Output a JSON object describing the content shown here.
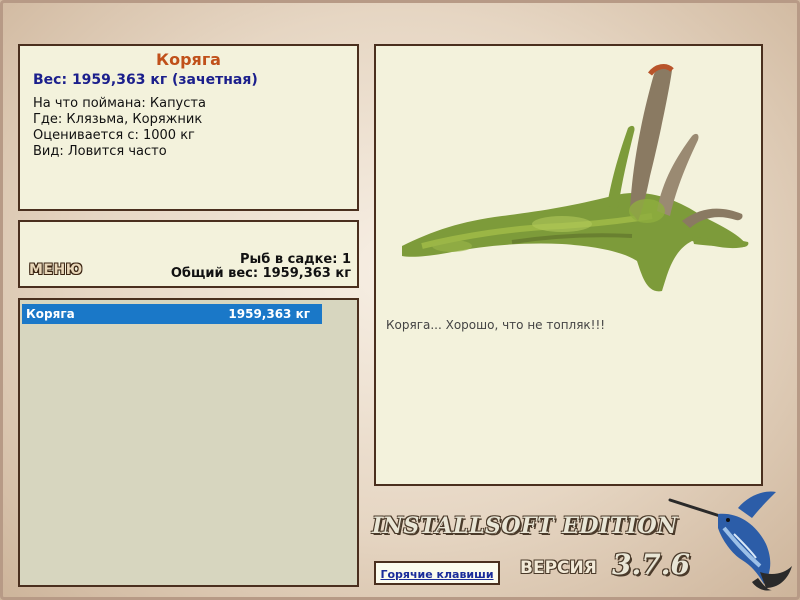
{
  "info": {
    "title": "Коряга",
    "weight": "Вес: 1959,363 кг (зачетная)",
    "lines": [
      "На что поймана: Капуста",
      "Где: Клязьма, Коряжник",
      "Оценивается с: 1000 кг",
      "Вид: Ловится часто"
    ]
  },
  "summary": {
    "menu_label": "МЕНЮ",
    "count": "Рыб в садке: 1",
    "total": "Общий вес: 1959,363 кг"
  },
  "catch_list": [
    {
      "name": "Коряга",
      "weight": "1959,363 кг",
      "selected": true
    }
  ],
  "detail": {
    "image": "driftwood-snag-photo",
    "comment": "Коряга... Хорошо, что не топляк!!!"
  },
  "footer": {
    "hotkeys_link": "Горячие клавиши",
    "brand": "INSTALLSOFT EDITION",
    "version_label": "ВЕРСИЯ",
    "version_number": "3.7.6",
    "logo": "marlin-logo"
  },
  "colors": {
    "title": "#c0501a",
    "weight": "#1b1f8c",
    "selection": "#1a78c8",
    "panel_bg": "#f3f2dc",
    "list_bg": "#d7d6bf",
    "border": "#4a2f1e"
  }
}
